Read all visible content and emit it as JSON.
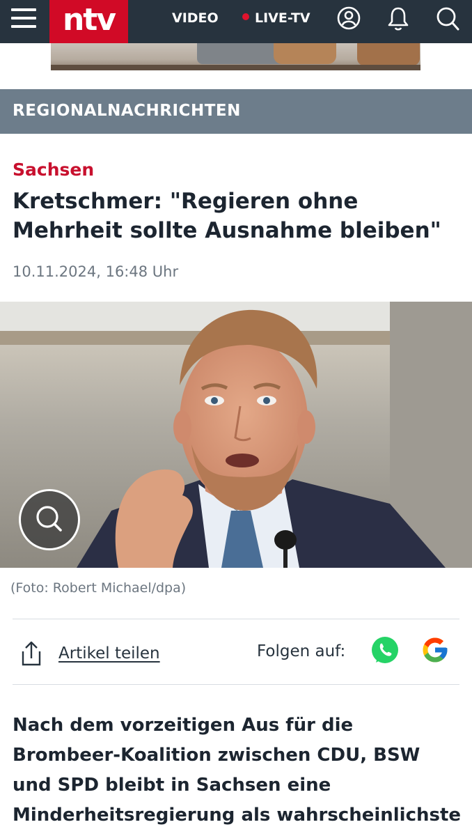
{
  "header": {
    "logo_text": "ntv",
    "nav_video": "VIDEO",
    "nav_live": "LIVE-TV",
    "brand_color": "#d10a26",
    "bar_color": "#27333e",
    "icons": [
      "menu-icon",
      "user-icon",
      "bell-icon",
      "search-icon"
    ]
  },
  "section": {
    "label": "REGIONALNACHRICHTEN",
    "color": "#6d7d8b"
  },
  "article": {
    "kicker": "Sachsen",
    "kicker_color": "#c8102e",
    "headline": "Kretschmer: \"Regieren ohne Mehrheit sollte Ausnahme bleiben\"",
    "date": "10.11.2024, 16:48 Uhr",
    "photo_caption": "(Foto: Robert Michael/dpa)",
    "lead": "Nach dem vorzeitigen Aus für die Brombeer-Koalition zwischen CDU, BSW und SPD bleibt in Sachsen eine Minderheitsregierung als wahrscheinlichste Option. Die müsse gut"
  },
  "share_bar": {
    "share_label": "Artikel teilen",
    "follow_label": "Folgen auf:",
    "icons": [
      "share-icon",
      "whatsapp-icon",
      "google-icon"
    ]
  }
}
